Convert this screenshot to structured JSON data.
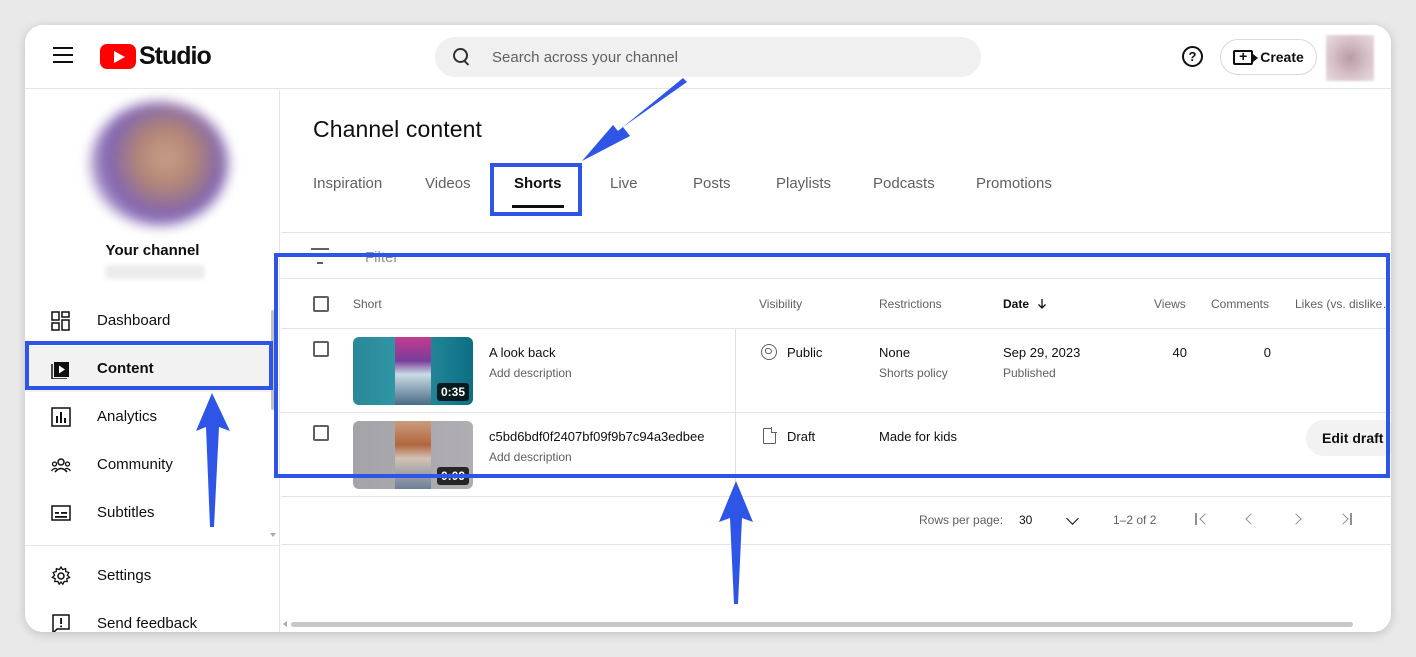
{
  "header": {
    "logo_text": "Studio",
    "search_placeholder": "Search across your channel",
    "help_glyph": "?",
    "create_label": "Create"
  },
  "sidebar": {
    "channel_title": "Your channel",
    "items": [
      {
        "label": "Dashboard",
        "icon": "dashboard-icon"
      },
      {
        "label": "Content",
        "icon": "content-icon",
        "active": true
      },
      {
        "label": "Analytics",
        "icon": "analytics-icon"
      },
      {
        "label": "Community",
        "icon": "community-icon"
      },
      {
        "label": "Subtitles",
        "icon": "subtitles-icon"
      }
    ],
    "footer_items": [
      {
        "label": "Settings",
        "icon": "gear-icon"
      },
      {
        "label": "Send feedback",
        "icon": "feedback-icon"
      }
    ]
  },
  "main": {
    "title": "Channel content",
    "tabs": [
      {
        "label": "Inspiration"
      },
      {
        "label": "Videos"
      },
      {
        "label": "Shorts",
        "active": true
      },
      {
        "label": "Live"
      },
      {
        "label": "Posts"
      },
      {
        "label": "Playlists"
      },
      {
        "label": "Podcasts"
      },
      {
        "label": "Promotions"
      }
    ],
    "filter_label": "Filter",
    "table": {
      "columns": {
        "short": "Short",
        "visibility": "Visibility",
        "restrictions": "Restrictions",
        "date": "Date",
        "views": "Views",
        "comments": "Comments",
        "likes": "Likes (vs. dislike…"
      },
      "rows": [
        {
          "title": "A look back",
          "description": "Add description",
          "duration": "0:35",
          "visibility": "Public",
          "visibility_icon": "globe-icon",
          "restriction": "None",
          "restriction_sub": "Shorts policy",
          "date": "Sep 29, 2023",
          "date_sub": "Published",
          "views": "40",
          "comments": "0"
        },
        {
          "title": "c5bd6bdf0f2407bf09f9b7c94a3edbee",
          "description": "Add description",
          "duration": "0:09",
          "visibility": "Draft",
          "visibility_icon": "document-icon",
          "restriction": "Made for kids",
          "action": "Edit draft"
        }
      ]
    },
    "pagination": {
      "rows_per_page_label": "Rows per page:",
      "rows_per_page": "30",
      "range": "1–2 of 2"
    }
  },
  "annotations": {
    "highlight_color": "#2f55e6"
  }
}
